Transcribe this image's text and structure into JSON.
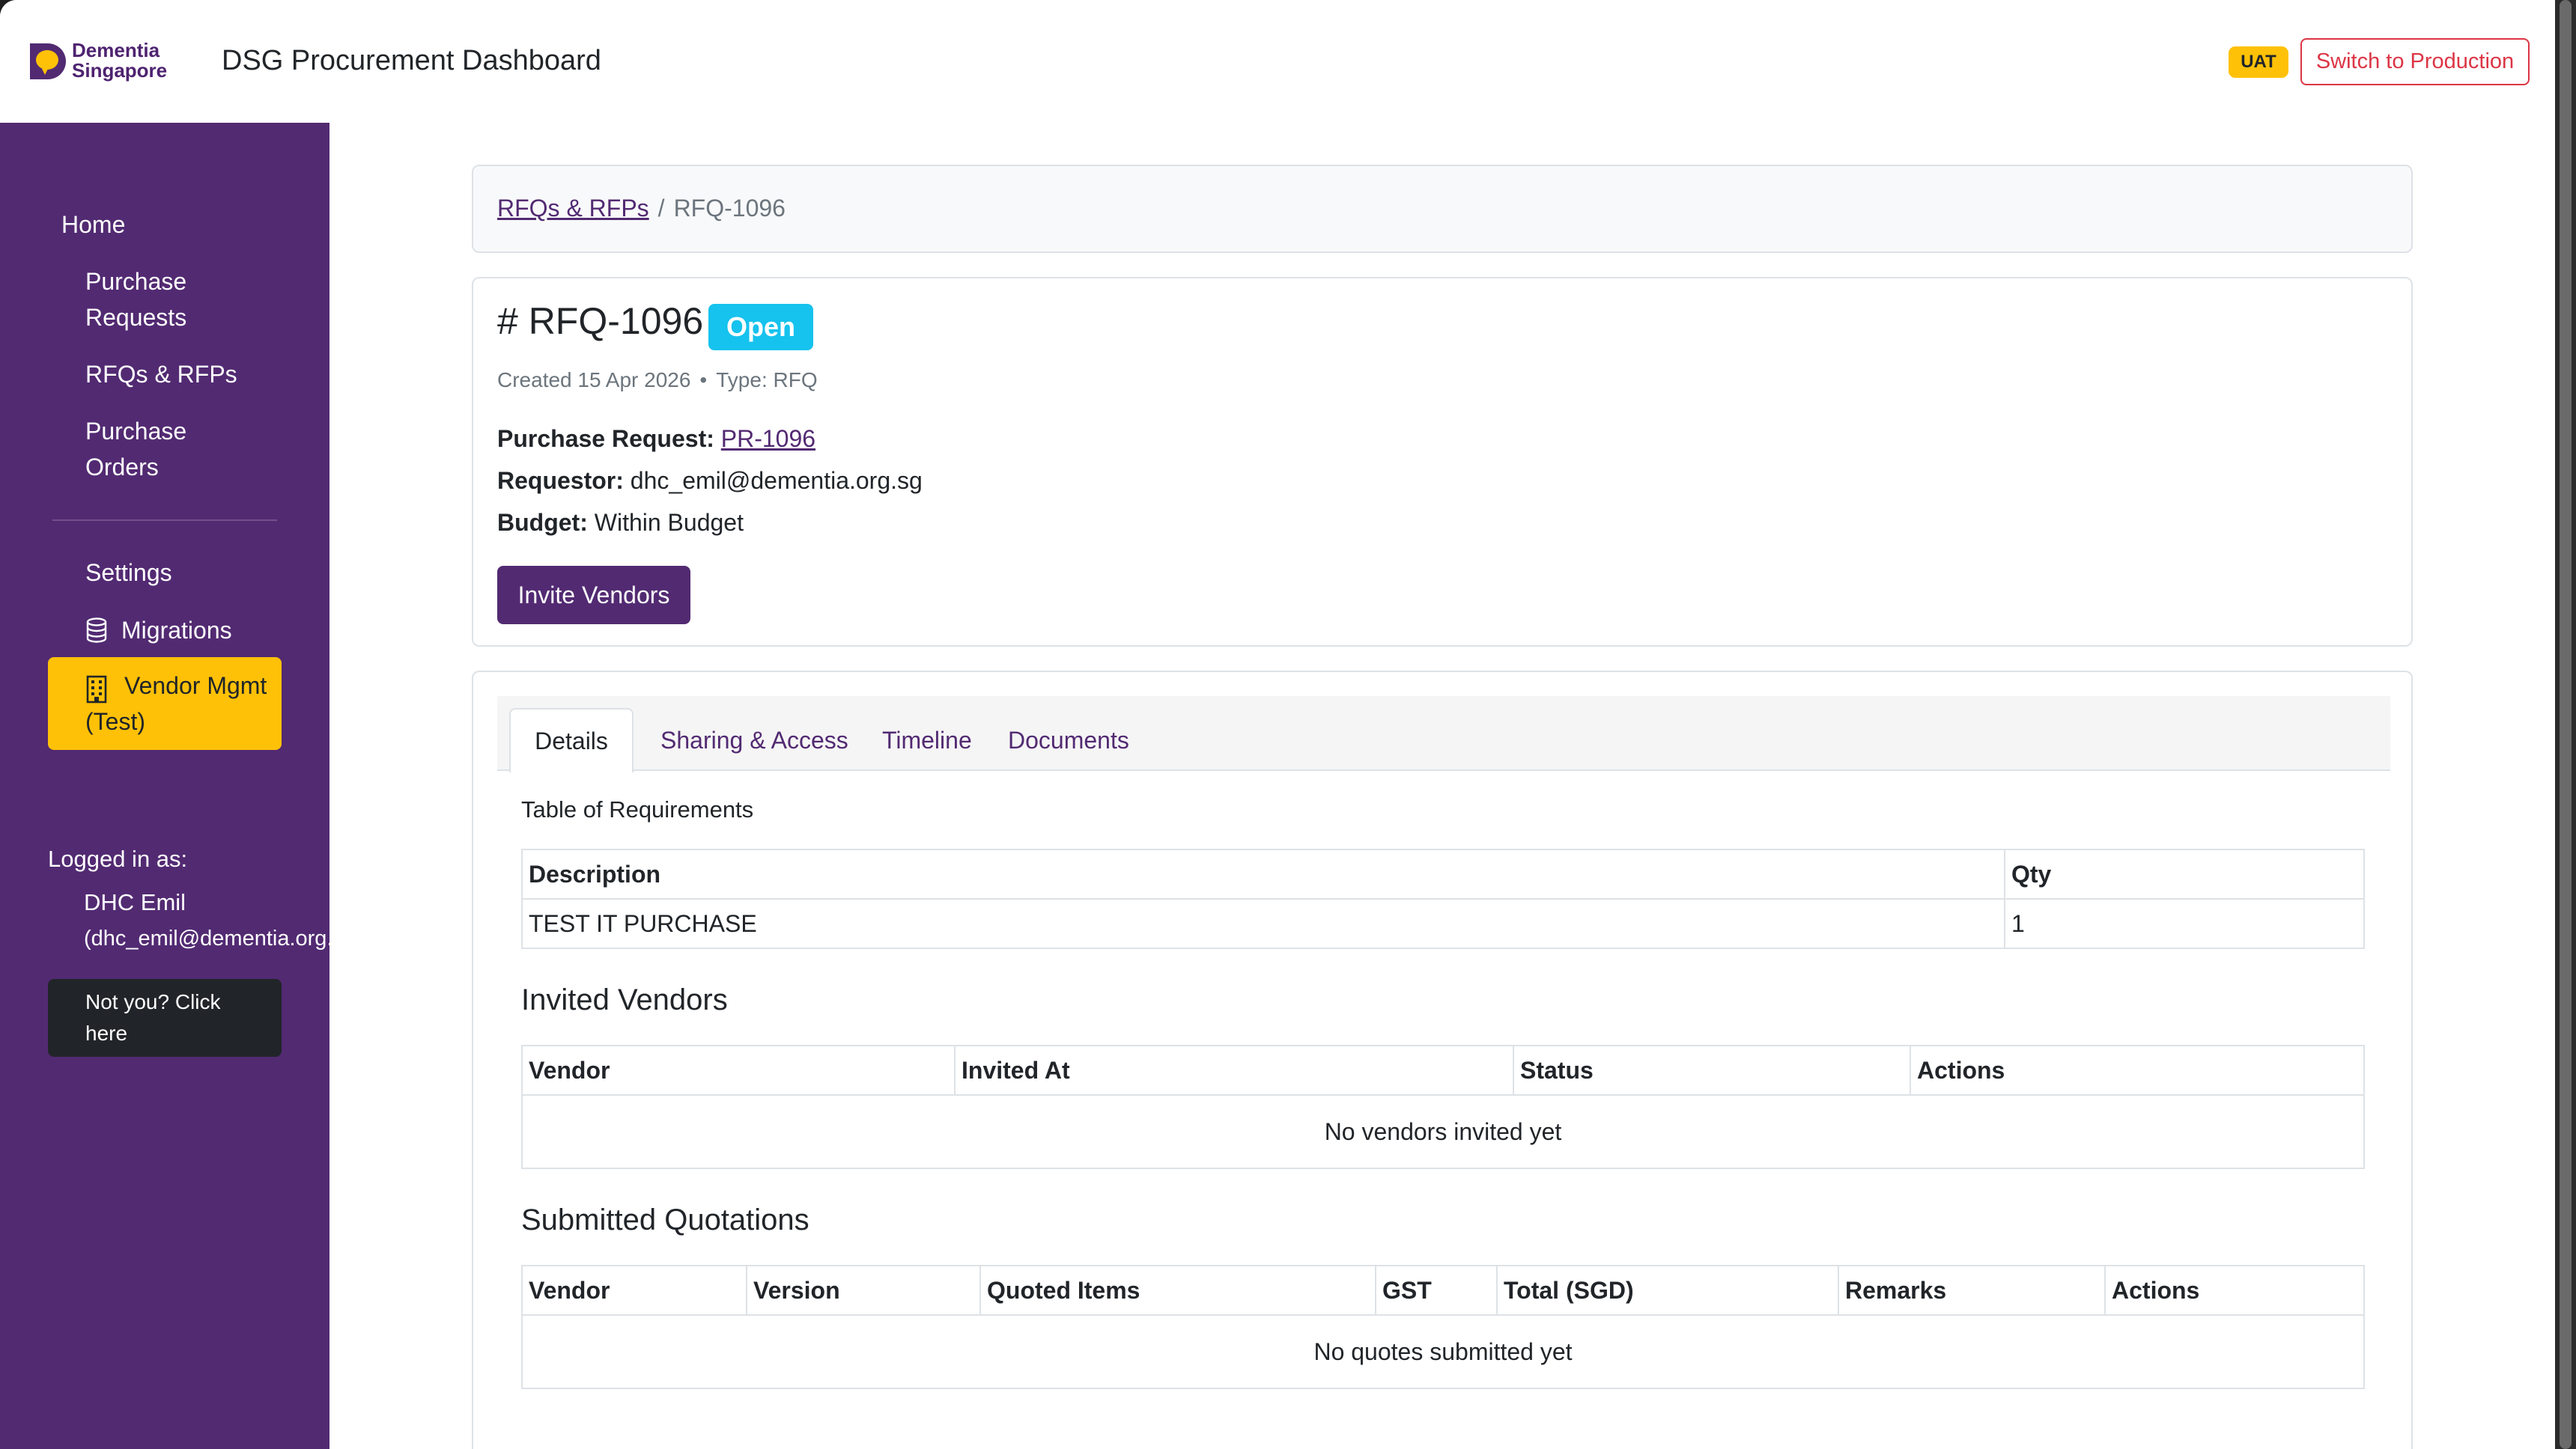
{
  "header": {
    "logo_line1": "Dementia",
    "logo_line2": "Singapore",
    "app_title": "DSG Procurement Dashboard",
    "env_badge": "UAT",
    "switch_label": "Switch to Production",
    "brand_color": "#522a72",
    "danger_color": "#dc3545"
  },
  "sidebar": {
    "home": "Home",
    "purchase_requests": "Purchase Requests",
    "rfqs": "RFQs & RFPs",
    "purchase_orders": "Purchase Orders",
    "settings": "Settings",
    "migrations": "Migrations",
    "vendor_mgmt": "Vendor Mgmt (Test)",
    "logged_in_label": "Logged in as:",
    "user_name": "DHC Emil",
    "user_email": "(dhc_emil@dementia.org.",
    "not_you": "Not you? Click here",
    "active_color": "#ffc107"
  },
  "breadcrumb": {
    "parent": "RFQs & RFPs",
    "separator": "/",
    "current": "RFQ-1096"
  },
  "rfq": {
    "title": "# RFQ-1096",
    "status": "Open",
    "status_color": "#16c2ee",
    "created": "Created 15 Apr 2026",
    "dot": "•",
    "type": "Type: RFQ",
    "pr_label": "Purchase Request:",
    "pr_value": "PR-1096",
    "requestor_label": "Requestor:",
    "requestor_value": "dhc_emil@dementia.org.sg",
    "budget_label": "Budget:",
    "budget_value": "Within Budget",
    "invite_button": "Invite Vendors"
  },
  "tabs": {
    "details": "Details",
    "sharing": "Sharing & Access",
    "timeline": "Timeline",
    "documents": "Documents"
  },
  "requirements": {
    "label": "Table of Requirements",
    "headers": [
      "Description",
      "Qty"
    ],
    "rows": [
      [
        "TEST IT PURCHASE",
        "1"
      ]
    ]
  },
  "vendors": {
    "title": "Invited Vendors",
    "headers": [
      "Vendor",
      "Invited At",
      "Status",
      "Actions"
    ],
    "empty": "No vendors invited yet"
  },
  "quotes": {
    "title": "Submitted Quotations",
    "headers": [
      "Vendor",
      "Version",
      "Quoted Items",
      "GST",
      "Total (SGD)",
      "Remarks",
      "Actions"
    ],
    "empty": "No quotes submitted yet"
  }
}
